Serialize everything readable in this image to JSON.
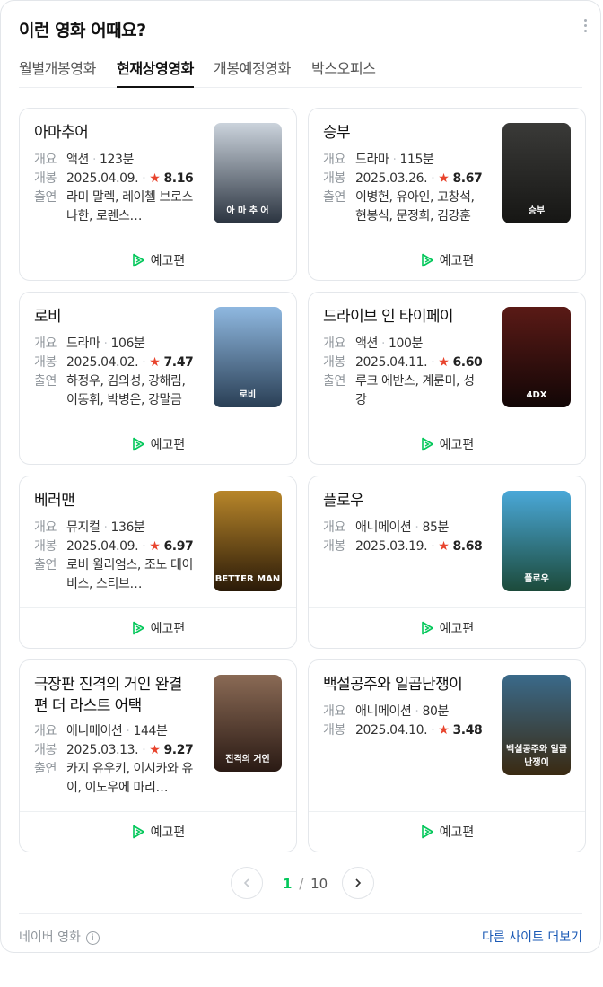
{
  "header": {
    "title": "이런 영화 어때요?"
  },
  "tabs": [
    {
      "label": "월별개봉영화"
    },
    {
      "label": "현재상영영화"
    },
    {
      "label": "개봉예정영화"
    },
    {
      "label": "박스오피스"
    }
  ],
  "labels": {
    "genre": "개요",
    "release": "개봉",
    "cast": "출연",
    "trailer": "예고편"
  },
  "movies": [
    {
      "title": "아마추어",
      "genre": "액션",
      "runtime": "123분",
      "date": "2025.04.09.",
      "rating": "8.16",
      "cast": "라미 말렉, 레이첼 브로스나한, 로렌스…",
      "poster_text": "아 마 추 어",
      "poster_colors": [
        "#cbd3dc",
        "#2b3440"
      ]
    },
    {
      "title": "승부",
      "genre": "드라마",
      "runtime": "115분",
      "date": "2025.03.26.",
      "rating": "8.67",
      "cast": "이병헌, 유아인, 고창석, 현봉식, 문정희, 김강훈",
      "poster_text": "승부",
      "poster_colors": [
        "#3a3a38",
        "#161614"
      ]
    },
    {
      "title": "로비",
      "genre": "드라마",
      "runtime": "106분",
      "date": "2025.04.02.",
      "rating": "7.47",
      "cast": "하정우, 김의성, 강해림, 이동휘, 박병은, 강말금",
      "poster_text": "로비",
      "poster_colors": [
        "#8fb8e0",
        "#2a3f55"
      ]
    },
    {
      "title": "드라이브 인 타이페이",
      "genre": "액션",
      "runtime": "100분",
      "date": "2025.04.11.",
      "rating": "6.60",
      "cast": "루크 에반스, 계륜미, 성강",
      "poster_text": "4DX",
      "poster_colors": [
        "#5a1a16",
        "#120606"
      ]
    },
    {
      "title": "베러맨",
      "genre": "뮤지컬",
      "runtime": "136분",
      "date": "2025.04.09.",
      "rating": "6.97",
      "cast": "로비 윌리엄스, 조노 데이비스, 스티브…",
      "poster_text": "BETTER MAN",
      "poster_colors": [
        "#b8862a",
        "#2a1a08"
      ]
    },
    {
      "title": "플로우",
      "genre": "애니메이션",
      "runtime": "85분",
      "date": "2025.03.19.",
      "rating": "8.68",
      "cast": "",
      "poster_text": "플로우",
      "poster_colors": [
        "#4aa8d8",
        "#1c4a3a"
      ]
    },
    {
      "title": "극장판 진격의 거인 완결편 더 라스트 어택",
      "genre": "애니메이션",
      "runtime": "144분",
      "date": "2025.03.13.",
      "rating": "9.27",
      "cast": "카지 유우키, 이시카와 유이, 이노우에 마리…",
      "poster_text": "진격의 거인",
      "poster_colors": [
        "#8a6a55",
        "#2a1a14"
      ]
    },
    {
      "title": "백설공주와 일곱난쟁이",
      "genre": "애니메이션",
      "runtime": "80분",
      "date": "2025.04.10.",
      "rating": "3.48",
      "cast": "",
      "poster_text": "백설공주와 일곱난쟁이",
      "poster_colors": [
        "#3a6a8a",
        "#3a2a12"
      ]
    }
  ],
  "pagination": {
    "current": "1",
    "separator": "/",
    "total": "10"
  },
  "footer": {
    "source": "네이버 영화",
    "info_glyph": "i",
    "more_sites": "다른 사이트 더보기"
  }
}
